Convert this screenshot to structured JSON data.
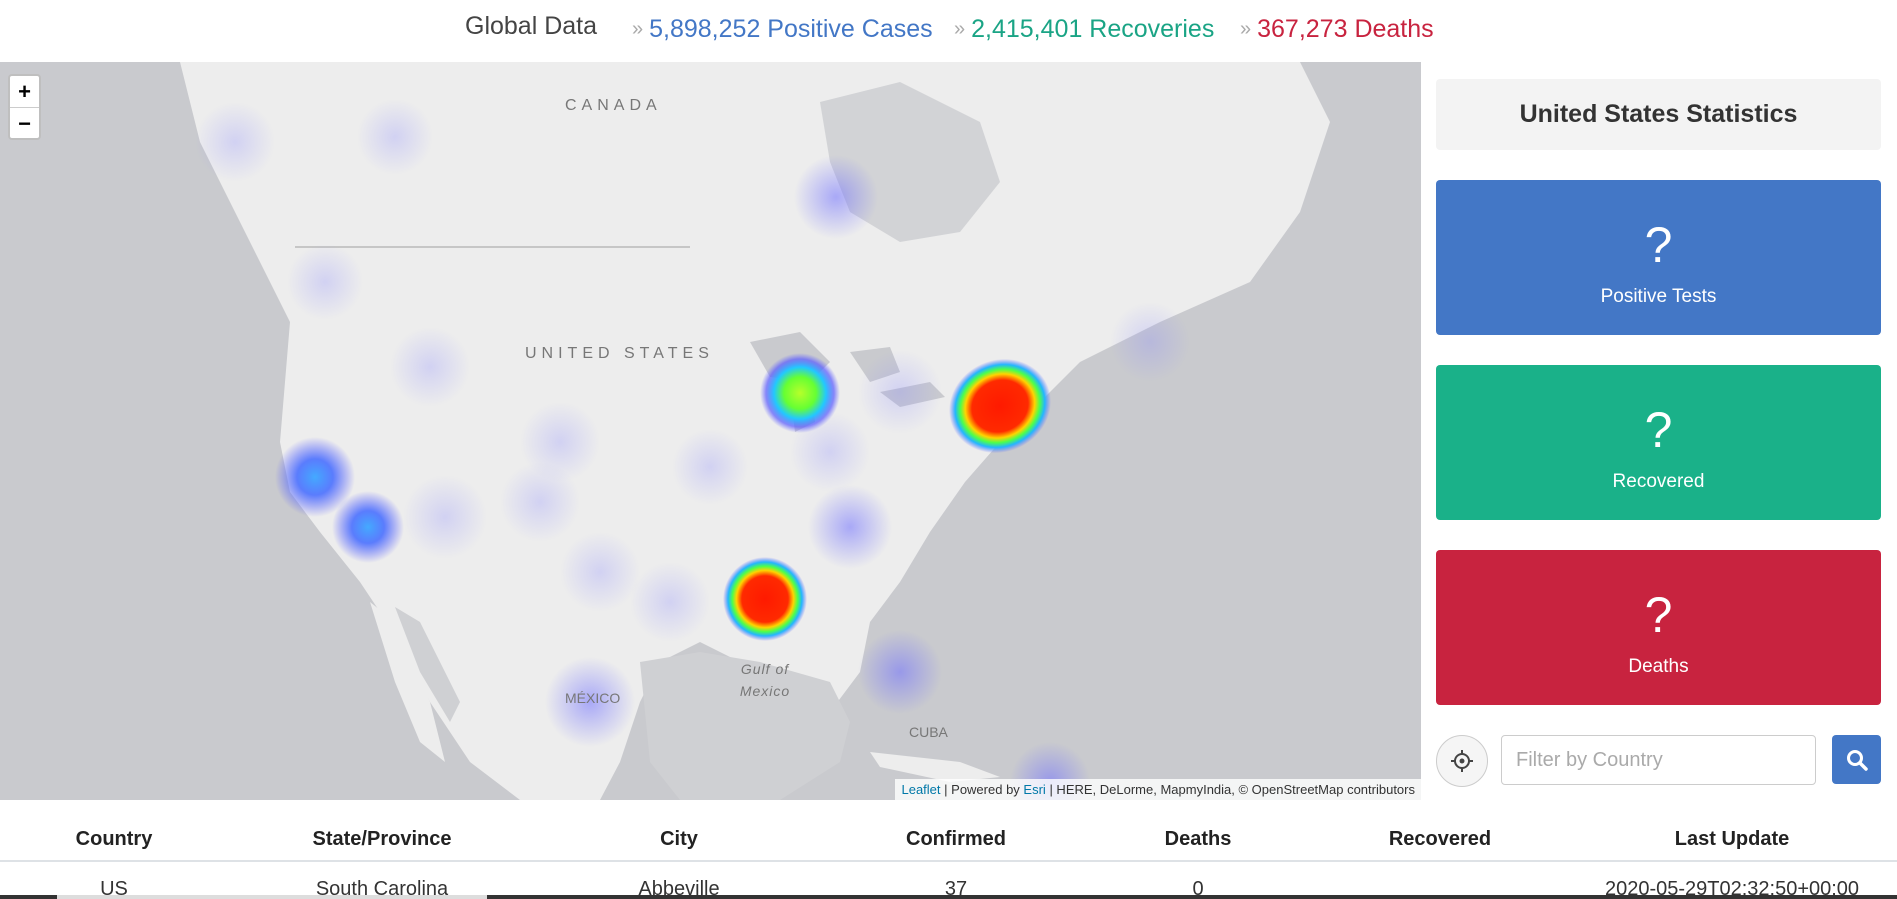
{
  "header": {
    "title": "Global Data",
    "separator": "»",
    "positive_cases": "5,898,252 Positive Cases",
    "recoveries": "2,415,401 Recoveries",
    "deaths": "367,273 Deaths"
  },
  "map": {
    "zoom_in": "+",
    "zoom_out": "−",
    "labels": {
      "canada": "CANADA",
      "united_states": "UNITED STATES",
      "mexico": "MÉXICO",
      "gulf": "Gulf of Mexico",
      "cuba": "CUBA"
    },
    "attribution": {
      "leaflet": "Leaflet",
      "powered_by": "| Powered by",
      "esri": "Esri",
      "rest": "| HERE, DeLorme, MapmyIndia, © OpenStreetMap contributors"
    }
  },
  "panel": {
    "title": "United States Statistics",
    "cards": {
      "positive": {
        "value": "?",
        "label": "Positive Tests"
      },
      "recovered": {
        "value": "?",
        "label": "Recovered"
      },
      "deaths": {
        "value": "?",
        "label": "Deaths"
      }
    },
    "filter_placeholder": "Filter by Country"
  },
  "table": {
    "headers": [
      "Country",
      "State/Province",
      "City",
      "Confirmed",
      "Deaths",
      "Recovered",
      "Last Update"
    ],
    "rows": [
      [
        "US",
        "South Carolina",
        "Abbeville",
        "37",
        "0",
        "",
        "2020-05-29T02:32:50+00:00"
      ]
    ]
  },
  "colors": {
    "blue": "#4377c6",
    "green": "#1ab189",
    "red": "#c8233f"
  },
  "icons": {
    "locate": "crosshair-icon",
    "search": "search-icon"
  }
}
